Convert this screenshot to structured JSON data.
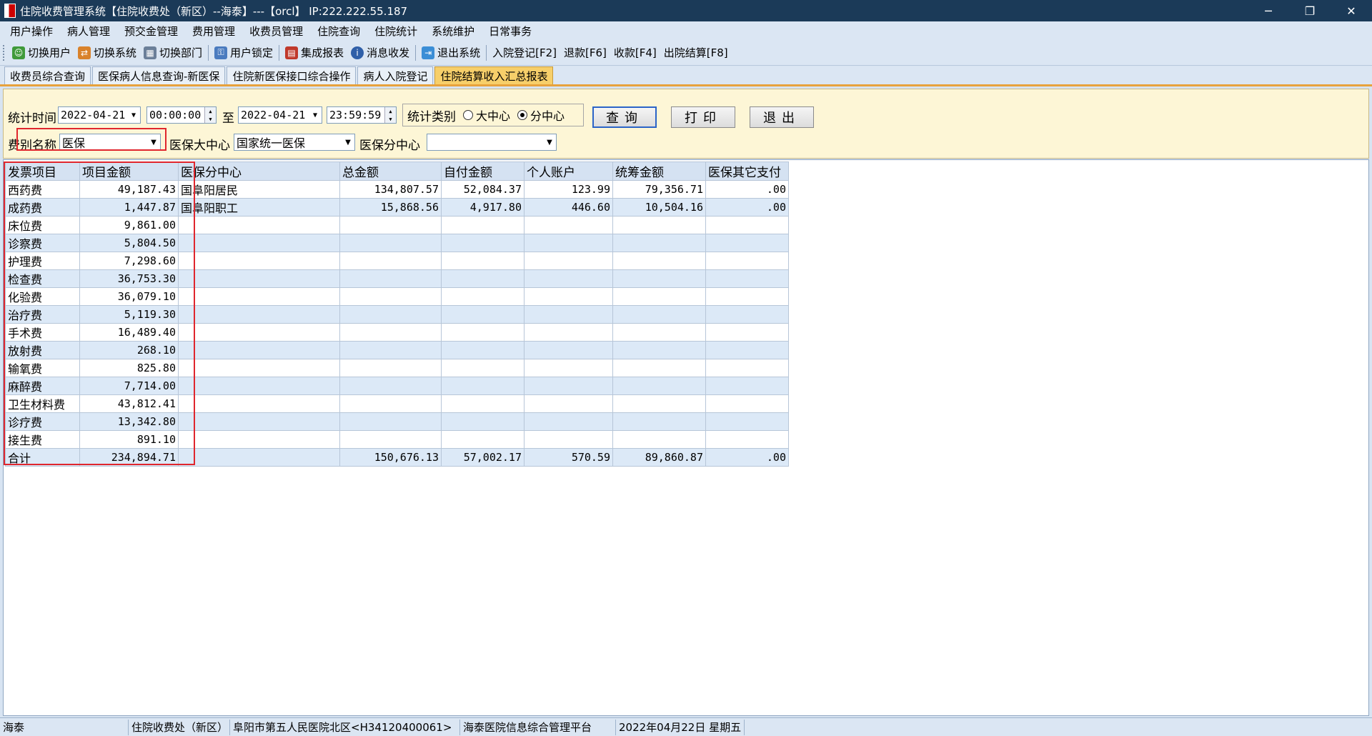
{
  "window": {
    "title": "住院收费管理系统【住院收费处（新区）--海泰】---【orcl】 IP:222.222.55.187",
    "minimize": "─",
    "restore": "❐",
    "close": "✕"
  },
  "menu": [
    "用户操作",
    "病人管理",
    "预交金管理",
    "费用管理",
    "收费员管理",
    "住院查询",
    "住院统计",
    "系统维护",
    "日常事务"
  ],
  "toolbar": [
    {
      "label": "切换用户",
      "icon": "users-icon",
      "color": "#3f9a3a",
      "glyph": "☺"
    },
    {
      "label": "切换系统",
      "icon": "switch-system-icon",
      "color": "#d9822b",
      "glyph": "⇄"
    },
    {
      "label": "切换部门",
      "icon": "department-icon",
      "color": "#6b7f99",
      "glyph": "▦"
    },
    {
      "label": "用户锁定",
      "icon": "user-lock-icon",
      "color": "#4a7bbf",
      "glyph": "⚿"
    },
    {
      "label": "集成报表",
      "icon": "report-icon",
      "color": "#c0392b",
      "glyph": "▤"
    },
    {
      "label": "消息收发",
      "icon": "info-icon",
      "color": "#2f5fa8",
      "glyph": "i"
    },
    {
      "label": "退出系统",
      "icon": "exit-icon",
      "color": "#3b8ed6",
      "glyph": "⇥"
    },
    {
      "label": "入院登记[F2]",
      "icon": "",
      "color": "",
      "glyph": ""
    },
    {
      "label": "退款[F6]",
      "icon": "",
      "color": "",
      "glyph": ""
    },
    {
      "label": "收款[F4]",
      "icon": "",
      "color": "",
      "glyph": ""
    },
    {
      "label": "出院结算[F8]",
      "icon": "",
      "color": "",
      "glyph": ""
    }
  ],
  "tabs": [
    "收费员综合查询",
    "医保病人信息查询-新医保",
    "住院新医保接口综合操作",
    "病人入院登记",
    "住院结算收入汇总报表"
  ],
  "filter": {
    "stat_time_label": "统计时间",
    "date_from": "2022-04-21",
    "time_from": "00:00:00",
    "to_label": "至",
    "date_to": "2022-04-21",
    "time_to": "23:59:59",
    "category_label": "统计类别",
    "radio_center": "大中心",
    "radio_branch": "分中心",
    "selected_radio": "分中心",
    "fee_name_label": "费别名称",
    "fee_name_value": "医保",
    "insurance_center_label": "医保大中心",
    "insurance_center_value": "国家统一医保",
    "insurance_branch_label": "医保分中心",
    "insurance_branch_value": "",
    "query_btn": "查询",
    "print_btn": "打印",
    "exit_btn": "退出"
  },
  "grid": {
    "columns": [
      "发票项目",
      "项目金额",
      "医保分中心",
      "总金额",
      "自付金额",
      "个人账户",
      "统筹金额",
      "医保其它支付"
    ],
    "rows": [
      [
        "西药费",
        "49,187.43",
        "国阜阳居民",
        "134,807.57",
        "52,084.37",
        "123.99",
        "79,356.71",
        ".00"
      ],
      [
        "成药费",
        "1,447.87",
        "国阜阳职工",
        "15,868.56",
        "4,917.80",
        "446.60",
        "10,504.16",
        ".00"
      ],
      [
        "床位费",
        "9,861.00",
        "",
        "",
        "",
        "",
        "",
        ""
      ],
      [
        "诊察费",
        "5,804.50",
        "",
        "",
        "",
        "",
        "",
        ""
      ],
      [
        "护理费",
        "7,298.60",
        "",
        "",
        "",
        "",
        "",
        ""
      ],
      [
        "检查费",
        "36,753.30",
        "",
        "",
        "",
        "",
        "",
        ""
      ],
      [
        "化验费",
        "36,079.10",
        "",
        "",
        "",
        "",
        "",
        ""
      ],
      [
        "治疗费",
        "5,119.30",
        "",
        "",
        "",
        "",
        "",
        ""
      ],
      [
        "手术费",
        "16,489.40",
        "",
        "",
        "",
        "",
        "",
        ""
      ],
      [
        "放射费",
        "268.10",
        "",
        "",
        "",
        "",
        "",
        ""
      ],
      [
        "输氧费",
        "825.80",
        "",
        "",
        "",
        "",
        "",
        ""
      ],
      [
        "麻醉费",
        "7,714.00",
        "",
        "",
        "",
        "",
        "",
        ""
      ],
      [
        "卫生材料费",
        "43,812.41",
        "",
        "",
        "",
        "",
        "",
        ""
      ],
      [
        "诊疗费",
        "13,342.80",
        "",
        "",
        "",
        "",
        "",
        ""
      ],
      [
        "接生费",
        "891.10",
        "",
        "",
        "",
        "",
        "",
        ""
      ],
      [
        "合计",
        "234,894.71",
        "",
        "150,676.13",
        "57,002.17",
        "570.59",
        "89,860.87",
        ".00"
      ]
    ]
  },
  "status": [
    "海泰",
    "住院收费处（新区）",
    "阜阳市第五人民医院北区<H34120400061>",
    "海泰医院信息综合管理平台",
    "2022年04月22日 星期五"
  ],
  "colors": {
    "titlebar": "#1b3a58",
    "active_tab": "#f7cf6a",
    "highlight_box": "#e0262d",
    "filter_bg": "#fdf6d6"
  }
}
